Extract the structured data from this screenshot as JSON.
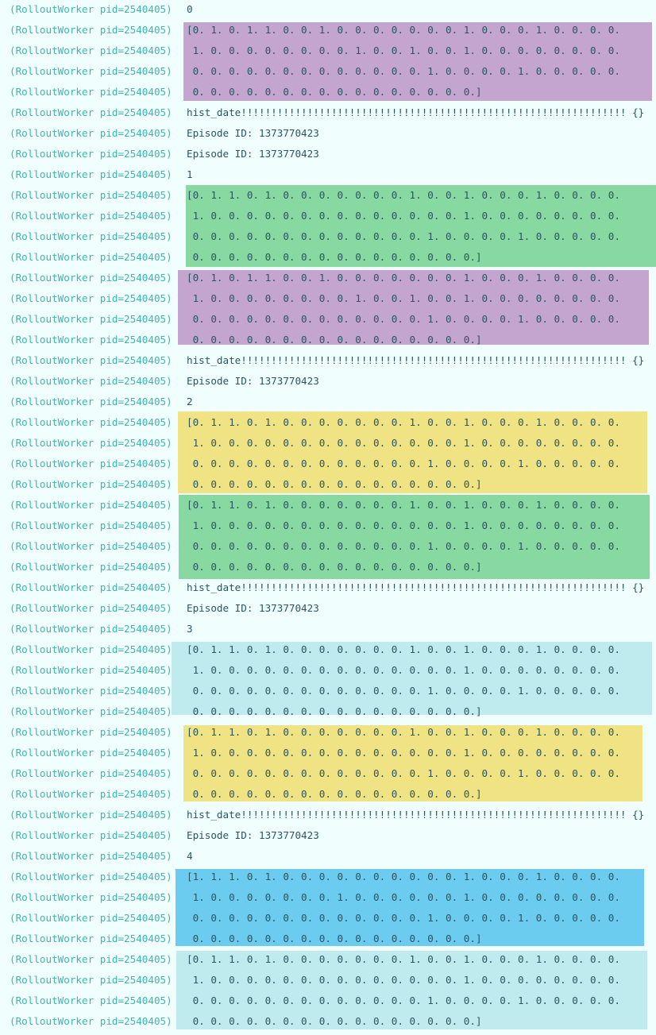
{
  "worker_prefix": "(RolloutWorker pid=2540405)",
  "colors": {
    "prefix_text": "#3fb5b1",
    "message_text": "#2a5560",
    "background": "#f0fffe",
    "highlight_purple": "#c4a5cf",
    "highlight_green": "#88d8a2",
    "highlight_yellow": "#f0e384",
    "highlight_light_cyan": "#bfebef",
    "highlight_blue": "#6cccef"
  },
  "lines": [
    "0",
    "[0. 1. 0. 1. 1. 0. 0. 1. 0. 0. 0. 0. 0. 0. 0. 1. 0. 0. 0. 1. 0. 0. 0. 0.",
    " 1. 0. 0. 0. 0. 0. 0. 0. 0. 1. 0. 0. 1. 0. 0. 1. 0. 0. 0. 0. 0. 0. 0. 0.",
    " 0. 0. 0. 0. 0. 0. 0. 0. 0. 0. 0. 0. 0. 1. 0. 0. 0. 0. 1. 0. 0. 0. 0. 0.",
    " 0. 0. 0. 0. 0. 0. 0. 0. 0. 0. 0. 0. 0. 0. 0. 0.]",
    "hist_date!!!!!!!!!!!!!!!!!!!!!!!!!!!!!!!!!!!!!!!!!!!!!!!!!!!!!!!!!!!!!!!! {}",
    "Episode ID: 1373770423",
    "Episode ID: 1373770423",
    "1",
    "[0. 1. 1. 0. 1. 0. 0. 0. 0. 0. 0. 0. 1. 0. 0. 1. 0. 0. 0. 1. 0. 0. 0. 0.",
    " 1. 0. 0. 0. 0. 0. 0. 0. 0. 0. 0. 0. 0. 0. 0. 1. 0. 0. 0. 0. 0. 0. 0. 0.",
    " 0. 0. 0. 0. 0. 0. 0. 0. 0. 0. 0. 0. 0. 1. 0. 0. 0. 0. 1. 0. 0. 0. 0. 0.",
    " 0. 0. 0. 0. 0. 0. 0. 0. 0. 0. 0. 0. 0. 0. 0. 0.]",
    "[0. 1. 0. 1. 1. 0. 0. 1. 0. 0. 0. 0. 0. 0. 0. 1. 0. 0. 0. 1. 0. 0. 0. 0.",
    " 1. 0. 0. 0. 0. 0. 0. 0. 0. 1. 0. 0. 1. 0. 0. 1. 0. 0. 0. 0. 0. 0. 0. 0.",
    " 0. 0. 0. 0. 0. 0. 0. 0. 0. 0. 0. 0. 0. 1. 0. 0. 0. 0. 1. 0. 0. 0. 0. 0.",
    " 0. 0. 0. 0. 0. 0. 0. 0. 0. 0. 0. 0. 0. 0. 0. 0.]",
    "hist_date!!!!!!!!!!!!!!!!!!!!!!!!!!!!!!!!!!!!!!!!!!!!!!!!!!!!!!!!!!!!!!!! {}",
    "Episode ID: 1373770423",
    "2",
    "[0. 1. 1. 0. 1. 0. 0. 0. 0. 0. 0. 0. 1. 0. 0. 1. 0. 0. 0. 1. 0. 0. 0. 0.",
    " 1. 0. 0. 0. 0. 0. 0. 0. 0. 0. 0. 0. 0. 0. 0. 1. 0. 0. 0. 0. 0. 0. 0. 0.",
    " 0. 0. 0. 0. 0. 0. 0. 0. 0. 0. 0. 0. 0. 1. 0. 0. 0. 0. 1. 0. 0. 0. 0. 0.",
    " 0. 0. 0. 0. 0. 0. 0. 0. 0. 0. 0. 0. 0. 0. 0. 0.]",
    "[0. 1. 1. 0. 1. 0. 0. 0. 0. 0. 0. 0. 1. 0. 0. 1. 0. 0. 0. 1. 0. 0. 0. 0.",
    " 1. 0. 0. 0. 0. 0. 0. 0. 0. 0. 0. 0. 0. 0. 0. 1. 0. 0. 0. 0. 0. 0. 0. 0.",
    " 0. 0. 0. 0. 0. 0. 0. 0. 0. 0. 0. 0. 0. 1. 0. 0. 0. 0. 1. 0. 0. 0. 0. 0.",
    " 0. 0. 0. 0. 0. 0. 0. 0. 0. 0. 0. 0. 0. 0. 0. 0.]",
    "hist_date!!!!!!!!!!!!!!!!!!!!!!!!!!!!!!!!!!!!!!!!!!!!!!!!!!!!!!!!!!!!!!!! {}",
    "Episode ID: 1373770423",
    "3",
    "[0. 1. 1. 0. 1. 0. 0. 0. 0. 0. 0. 0. 1. 0. 0. 1. 0. 0. 0. 1. 0. 0. 0. 0.",
    " 1. 0. 0. 0. 0. 0. 0. 0. 0. 0. 0. 0. 0. 0. 0. 1. 0. 0. 0. 0. 0. 0. 0. 0.",
    " 0. 0. 0. 0. 0. 0. 0. 0. 0. 0. 0. 0. 0. 1. 0. 0. 0. 0. 1. 0. 0. 0. 0. 0.",
    " 0. 0. 0. 0. 0. 0. 0. 0. 0. 0. 0. 0. 0. 0. 0. 0.]",
    "[0. 1. 1. 0. 1. 0. 0. 0. 0. 0. 0. 0. 1. 0. 0. 1. 0. 0. 0. 1. 0. 0. 0. 0.",
    " 1. 0. 0. 0. 0. 0. 0. 0. 0. 0. 0. 0. 0. 0. 0. 1. 0. 0. 0. 0. 0. 0. 0. 0.",
    " 0. 0. 0. 0. 0. 0. 0. 0. 0. 0. 0. 0. 0. 1. 0. 0. 0. 0. 1. 0. 0. 0. 0. 0.",
    " 0. 0. 0. 0. 0. 0. 0. 0. 0. 0. 0. 0. 0. 0. 0. 0.]",
    "hist_date!!!!!!!!!!!!!!!!!!!!!!!!!!!!!!!!!!!!!!!!!!!!!!!!!!!!!!!!!!!!!!!! {}",
    "Episode ID: 1373770423",
    "4",
    "[1. 1. 1. 0. 1. 0. 0. 0. 0. 0. 0. 0. 0. 0. 0. 1. 0. 0. 0. 1. 0. 0. 0. 0.",
    " 1. 0. 0. 0. 0. 0. 0. 0. 1. 0. 0. 0. 0. 0. 0. 1. 0. 0. 0. 0. 0. 0. 0. 0.",
    " 0. 0. 0. 0. 0. 0. 0. 0. 0. 0. 0. 0. 0. 1. 0. 0. 0. 0. 1. 0. 0. 0. 0. 0.",
    " 0. 0. 0. 0. 0. 0. 0. 0. 0. 0. 0. 0. 0. 0. 0. 0.]",
    "[0. 1. 1. 0. 1. 0. 0. 0. 0. 0. 0. 0. 1. 0. 0. 1. 0. 0. 0. 1. 0. 0. 0. 0.",
    " 1. 0. 0. 0. 0. 0. 0. 0. 0. 0. 0. 0. 0. 0. 0. 1. 0. 0. 0. 0. 0. 0. 0. 0.",
    " 0. 0. 0. 0. 0. 0. 0. 0. 0. 0. 0. 0. 0. 1. 0. 0. 0. 0. 1. 0. 0. 0. 0. 0.",
    " 0. 0. 0. 0. 0. 0. 0. 0. 0. 0. 0. 0. 0. 0. 0. 0.]"
  ]
}
